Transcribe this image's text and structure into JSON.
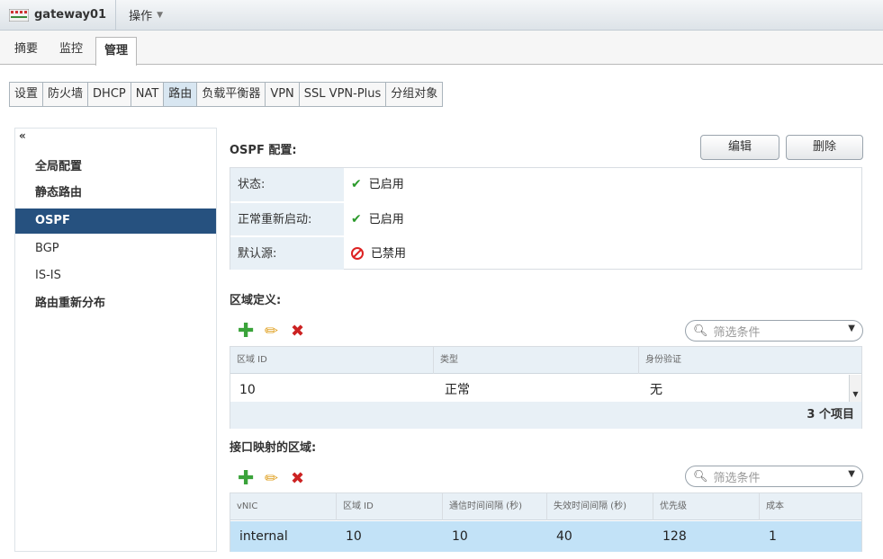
{
  "header": {
    "host_name": "gateway01",
    "actions_label": "操作",
    "actions_caret": "▼"
  },
  "top_tabs": [
    {
      "label": "摘要"
    },
    {
      "label": "监控"
    },
    {
      "label": "管理",
      "active": true
    }
  ],
  "sub_tabs": [
    {
      "label": "设置"
    },
    {
      "label": "防火墙"
    },
    {
      "label": "DHCP"
    },
    {
      "label": "NAT"
    },
    {
      "label": "路由",
      "active": true
    },
    {
      "label": "负载平衡器"
    },
    {
      "label": "VPN"
    },
    {
      "label": "SSL VPN-Plus"
    },
    {
      "label": "分组对象"
    }
  ],
  "left_nav": {
    "collapse_glyph": "«",
    "items": [
      {
        "label": "全局配置"
      },
      {
        "label": "静态路由"
      },
      {
        "label": "OSPF",
        "active": true
      },
      {
        "label": "BGP"
      },
      {
        "label": "IS-IS"
      },
      {
        "label": "路由重新分布"
      }
    ]
  },
  "ospf_config": {
    "title": "OSPF 配置:",
    "edit_label": "编辑",
    "delete_label": "删除",
    "rows": [
      {
        "key": "状态:",
        "value": "已启用",
        "status": "enabled"
      },
      {
        "key": "正常重新启动:",
        "value": "已启用",
        "status": "enabled"
      },
      {
        "key": "默认源:",
        "value": "已禁用",
        "status": "disabled"
      }
    ],
    "enabled_glyph": "✔"
  },
  "area_definitions": {
    "title": "区域定义:",
    "filter_placeholder": "筛选条件",
    "columns": [
      "区域 ID",
      "类型",
      "身份验证"
    ],
    "rows": [
      [
        "10",
        "正常",
        "无"
      ]
    ],
    "footer": "3 个项目"
  },
  "interface_mapping": {
    "title": "接口映射的区域:",
    "filter_placeholder": "筛选条件",
    "columns": [
      "vNIC",
      "区域 ID",
      "通信时间间隔 (秒)",
      "失效时间间隔 (秒)",
      "优先级",
      "成本"
    ],
    "rows": [
      [
        "internal",
        "10",
        "10",
        "40",
        "128",
        "1"
      ]
    ]
  },
  "icons": {
    "host": "gateway-icon",
    "add": "plus-icon",
    "edit": "pencil-icon",
    "delete": "close-icon",
    "search": "search-icon",
    "dropdown": "chevron-down-icon"
  },
  "colors": {
    "nav_active_bg": "#26517f",
    "key_cell_bg": "#e8f0f6",
    "selected_row_bg": "#c2e2f7",
    "enabled_green": "#2b9a2b",
    "disabled_red": "#dd2222"
  }
}
